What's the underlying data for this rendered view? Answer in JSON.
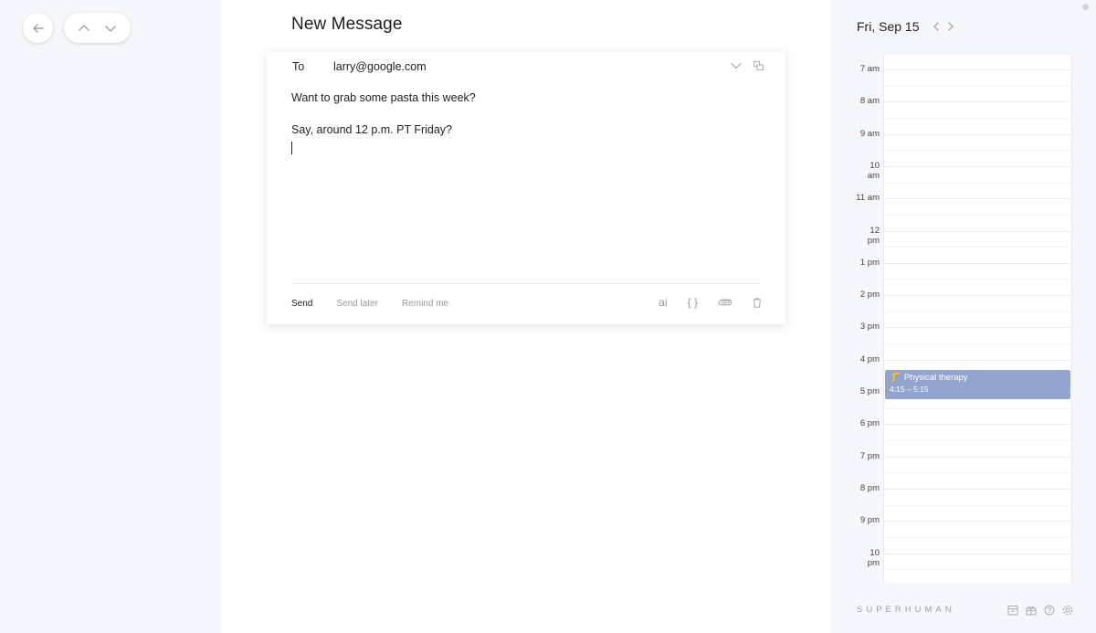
{
  "compose": {
    "title": "New Message",
    "to_label": "To",
    "to_value": "larry@google.com",
    "subject": "Want to grab some pasta this week?",
    "body": "Say, around 12 p.m. PT Friday?",
    "actions": {
      "send": "Send",
      "send_later": "Send later",
      "remind_me": "Remind me"
    },
    "tools": {
      "ai": "ai",
      "snippets": "{ }"
    }
  },
  "calendar": {
    "date": "Fri, Sep 15",
    "hours": [
      "7 am",
      "8 am",
      "9 am",
      "10 am",
      "11 am",
      "12 pm",
      "1 pm",
      "2 pm",
      "3 pm",
      "4 pm",
      "5 pm",
      "6 pm",
      "7 pm",
      "8 pm",
      "9 pm",
      "10 pm"
    ],
    "event": {
      "icon": "🦵",
      "title": "Physical therapy",
      "time": "4:15 – 5:15",
      "color": "#93a5cf"
    }
  },
  "footer": {
    "brand": "SUPERHUMAN"
  }
}
